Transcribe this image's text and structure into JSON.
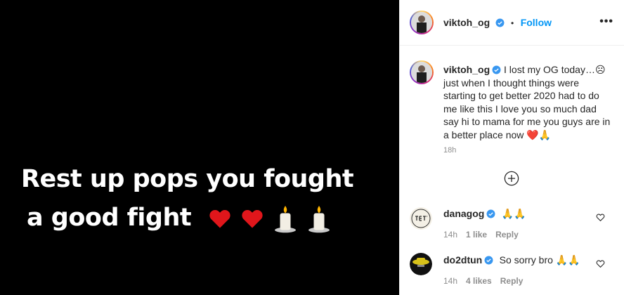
{
  "post": {
    "image_text_line1": "Rest up pops you fought",
    "image_text_line2": "a good fight",
    "emoji_names": [
      "red-heart",
      "red-heart",
      "candle",
      "candle"
    ]
  },
  "header": {
    "username": "viktoh_og",
    "separator": "•",
    "follow_label": "Follow",
    "more_label": "•••"
  },
  "caption": {
    "username": "viktoh_og",
    "text": "I lost my OG today…☹ just when I thought things were starting to get better 2020 had to do me like this I love you so much dad say hi to mama for me you guys are in a better place now ❤️🙏",
    "timestamp": "18h"
  },
  "load_more_icon": "plus-circle-icon",
  "comments": [
    {
      "username": "danagog",
      "text": "🙏🙏",
      "time": "14h",
      "likes": "1 like",
      "reply": "Reply"
    },
    {
      "username": "do2dtun",
      "text": "So sorry bro 🙏🙏",
      "time": "14h",
      "likes": "4 likes",
      "reply": "Reply"
    }
  ],
  "colors": {
    "accent": "#0095f6",
    "verified": "#3897f0",
    "muted": "#8e8e8e"
  }
}
